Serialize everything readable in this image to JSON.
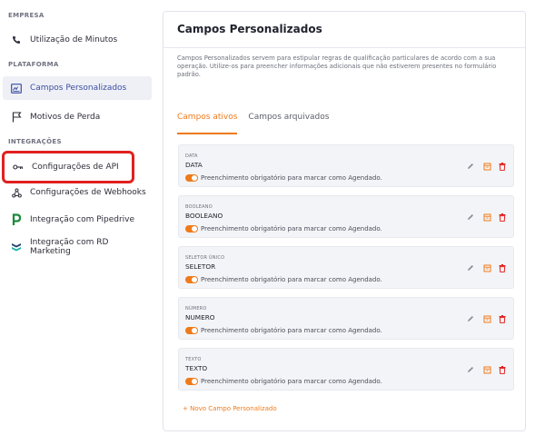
{
  "sidebar": {
    "sections": {
      "empresa": "EMPRESA",
      "plataforma": "PLATAFORMA",
      "integracoes": "INTEGRAÇÕES"
    },
    "items": [
      {
        "label": "Utilização de Minutos",
        "icon": "phone-icon"
      },
      {
        "label": "Campos Personalizados",
        "icon": "custom-fields-icon"
      },
      {
        "label": "Motivos de Perda",
        "icon": "flag-icon"
      },
      {
        "label": "Configurações de API",
        "icon": "key-icon"
      },
      {
        "label": "Configurações de Webhooks",
        "icon": "webhook-icon"
      },
      {
        "label": "Integração com Pipedrive",
        "icon": "pipedrive-icon"
      },
      {
        "label": "Integração com RD Marketing",
        "icon": "rd-marketing-icon"
      }
    ]
  },
  "main": {
    "title": "Campos Personalizados",
    "description": "Campos Personalizados servem para estipular regras de qualificação particulares de acordo com a sua operação. Utilize-os para preencher informações adicionais que não estiverem presentes no formulário padrão.",
    "tabs": [
      {
        "label": "Campos ativos",
        "active": true
      },
      {
        "label": "Campos arquivados",
        "active": false
      }
    ],
    "fields": [
      {
        "type": "DATA",
        "name": "DATA",
        "required_label": "Preenchimento obrigatório para marcar como Agendado."
      },
      {
        "type": "BOOLEANO",
        "name": "BOOLEANO",
        "required_label": "Preenchimento obrigatório para marcar como Agendado."
      },
      {
        "type": "SELETOR ÚNICO",
        "name": "SELETOR",
        "required_label": "Preenchimento obrigatório para marcar como Agendado."
      },
      {
        "type": "NÚMERO",
        "name": "NUMERO",
        "required_label": "Preenchimento obrigatório para marcar como Agendado."
      },
      {
        "type": "TEXTO",
        "name": "TEXTO",
        "required_label": "Preenchimento obrigatório para marcar como Agendado."
      }
    ],
    "add_label": "+ Novo Campo Personalizado"
  },
  "colors": {
    "accent": "#f07a1a",
    "active_nav": "#3b4ea0",
    "delete": "#e0211f",
    "highlight_box": "#e0211f"
  }
}
